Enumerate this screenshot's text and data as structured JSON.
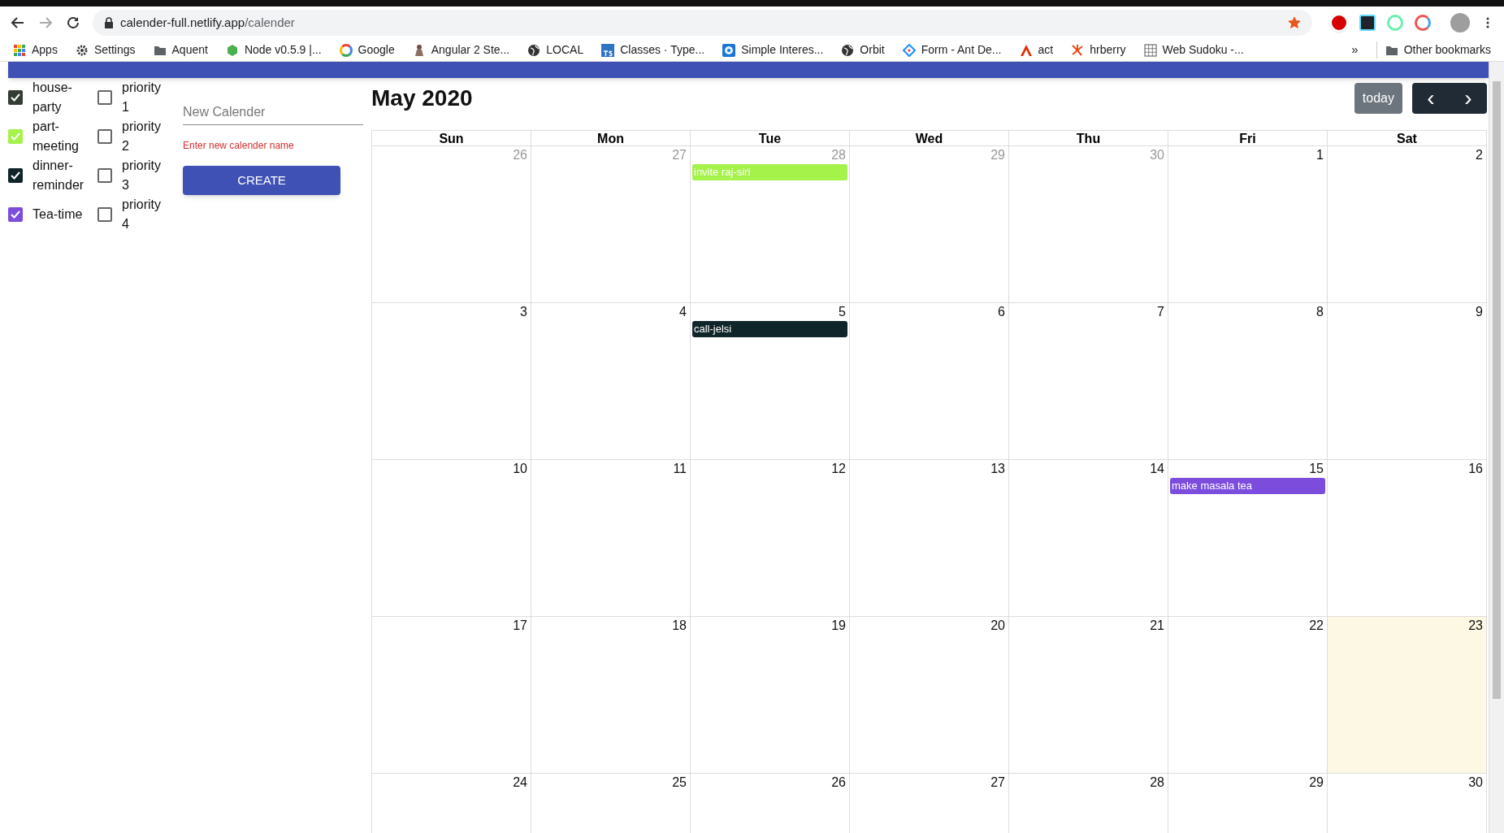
{
  "browser": {
    "url_host": "calender-full.netlify.app",
    "url_path": "/calender",
    "bookmarked": true,
    "bookmarks": [
      {
        "label": "Apps",
        "kind": "apps"
      },
      {
        "label": "Settings",
        "kind": "gear"
      },
      {
        "label": "Aquent",
        "kind": "folder"
      },
      {
        "label": "Node v0.5.9 |...",
        "kind": "hex"
      },
      {
        "label": "Google",
        "kind": "google"
      },
      {
        "label": "Angular 2 Ste...",
        "kind": "figure"
      },
      {
        "label": "LOCAL",
        "kind": "globe"
      },
      {
        "label": "Classes · Type...",
        "kind": "ts"
      },
      {
        "label": "Simple Interes...",
        "kind": "disc"
      },
      {
        "label": "Orbit",
        "kind": "globe"
      },
      {
        "label": "Form - Ant De...",
        "kind": "diamond"
      },
      {
        "label": "act",
        "kind": "triangle"
      },
      {
        "label": "hrberry",
        "kind": "burst"
      },
      {
        "label": "Web Sudoku -...",
        "kind": "grid"
      }
    ],
    "overflow": "»",
    "other_bookmarks": "Other bookmarks"
  },
  "calendars": [
    {
      "label": "house-party",
      "checked": true,
      "color": "#333d33"
    },
    {
      "label": "part-meeting",
      "checked": true,
      "color": "#a4f24a"
    },
    {
      "label": "dinner-reminder",
      "checked": true,
      "color": "#10252a"
    },
    {
      "label": "Tea-time",
      "checked": true,
      "color": "#7c4ddd"
    }
  ],
  "priorities": [
    {
      "label": "priority 1",
      "checked": false
    },
    {
      "label": "priority 2",
      "checked": false
    },
    {
      "label": "priority 3",
      "checked": false
    },
    {
      "label": "priority 4",
      "checked": false
    }
  ],
  "new_calendar": {
    "placeholder": "New Calender",
    "error": "Enter new calender name",
    "button": "CREATE"
  },
  "calendar": {
    "title": "May 2020",
    "today_button": "today",
    "prev": "‹",
    "next": "›",
    "weekdays": [
      "Sun",
      "Mon",
      "Tue",
      "Wed",
      "Thu",
      "Fri",
      "Sat"
    ],
    "weeks": [
      [
        {
          "day": "26",
          "muted": true
        },
        {
          "day": "27",
          "muted": true
        },
        {
          "day": "28",
          "muted": true,
          "events": [
            {
              "title": "invite raj-siri",
              "color": "#a4f24a"
            }
          ]
        },
        {
          "day": "29",
          "muted": true
        },
        {
          "day": "30",
          "muted": true
        },
        {
          "day": "1",
          "muted": false
        },
        {
          "day": "2",
          "muted": false
        }
      ],
      [
        {
          "day": "3",
          "muted": false
        },
        {
          "day": "4",
          "muted": false
        },
        {
          "day": "5",
          "muted": false,
          "events": [
            {
              "title": "call-jelsi",
              "color": "#10252a"
            }
          ]
        },
        {
          "day": "6",
          "muted": false
        },
        {
          "day": "7",
          "muted": false
        },
        {
          "day": "8",
          "muted": false
        },
        {
          "day": "9",
          "muted": false
        }
      ],
      [
        {
          "day": "10",
          "muted": false
        },
        {
          "day": "11",
          "muted": false
        },
        {
          "day": "12",
          "muted": false
        },
        {
          "day": "13",
          "muted": false
        },
        {
          "day": "14",
          "muted": false
        },
        {
          "day": "15",
          "muted": false,
          "events": [
            {
              "title": "make masala tea",
              "color": "#7c4ddd"
            }
          ]
        },
        {
          "day": "16",
          "muted": false
        }
      ],
      [
        {
          "day": "17",
          "muted": false
        },
        {
          "day": "18",
          "muted": false
        },
        {
          "day": "19",
          "muted": false
        },
        {
          "day": "20",
          "muted": false
        },
        {
          "day": "21",
          "muted": false
        },
        {
          "day": "22",
          "muted": false
        },
        {
          "day": "23",
          "muted": false,
          "today": true
        }
      ],
      [
        {
          "day": "24",
          "muted": false
        },
        {
          "day": "25",
          "muted": false
        },
        {
          "day": "26",
          "muted": false
        },
        {
          "day": "27",
          "muted": false
        },
        {
          "day": "28",
          "muted": false
        },
        {
          "day": "29",
          "muted": false
        },
        {
          "day": "30",
          "muted": false
        }
      ]
    ]
  }
}
